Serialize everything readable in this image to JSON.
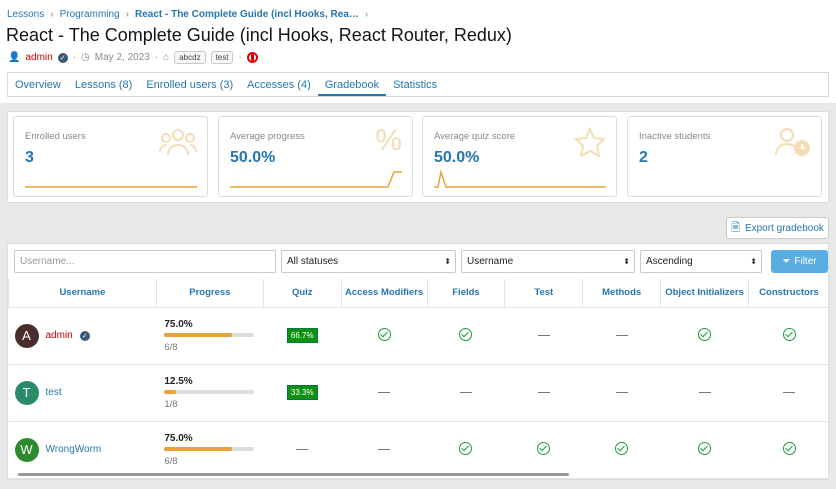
{
  "breadcrumbs": [
    "Lessons",
    "Programming",
    "React - The Complete Guide (incl Hooks, Rea…"
  ],
  "page_title": "React - The Complete Guide (incl Hooks, React Router, Redux)",
  "meta": {
    "author": "admin",
    "date": "May 2, 2023",
    "tags": [
      "abcdz",
      "test"
    ]
  },
  "tabs": [
    "Overview",
    "Lessons (8)",
    "Enrolled users (3)",
    "Accesses (4)",
    "Gradebook",
    "Statistics"
  ],
  "active_tab": "Gradebook",
  "stats": [
    {
      "label": "Enrolled users",
      "value": "3",
      "icon": "users-icon"
    },
    {
      "label": "Average progress",
      "value": "50.0%",
      "icon": "percent-icon"
    },
    {
      "label": "Average quiz score",
      "value": "50.0%",
      "icon": "star-icon"
    },
    {
      "label": "Inactive students",
      "value": "2",
      "icon": "user-clock-icon"
    }
  ],
  "export_label": "Export gradebook",
  "filters": {
    "username_placeholder": "Username...",
    "status": "All statuses",
    "sort_by": "Username",
    "order": "Ascending",
    "button": "Filter"
  },
  "columns": [
    "Username",
    "Progress",
    "Quiz",
    "Access Modifiers",
    "Fields",
    "Test",
    "Methods",
    "Object Initializers",
    "Constructors"
  ],
  "rows": [
    {
      "username": "admin",
      "avatar_letter": "A",
      "avatar_color": "#4a2c2c",
      "name_color": "#c00000",
      "verified": true,
      "progress_pct": "75.0%",
      "progress": 0.75,
      "fraction": "6/8",
      "quiz": "66.7%",
      "cells": [
        "check",
        "check",
        "dash",
        "dash",
        "check",
        "check"
      ]
    },
    {
      "username": "test",
      "avatar_letter": "T",
      "avatar_color": "#2a8a6a",
      "name_color": "#2577b1",
      "verified": false,
      "progress_pct": "12.5%",
      "progress": 0.125,
      "fraction": "1/8",
      "quiz": "33.3%",
      "cells": [
        "dash",
        "dash",
        "dash",
        "dash",
        "dash",
        "dash"
      ]
    },
    {
      "username": "WrongWorm",
      "avatar_letter": "W",
      "avatar_color": "#2f8a2f",
      "name_color": "#2577b1",
      "verified": false,
      "progress_pct": "75.0%",
      "progress": 0.75,
      "fraction": "6/8",
      "quiz": "",
      "cells": [
        "dash",
        "check",
        "check",
        "check",
        "check",
        "check"
      ]
    }
  ],
  "colors": {
    "accent": "#2577b1",
    "progress": "#e8a23a",
    "check": "#1a9d3a",
    "quiz_badge": "#109010"
  }
}
